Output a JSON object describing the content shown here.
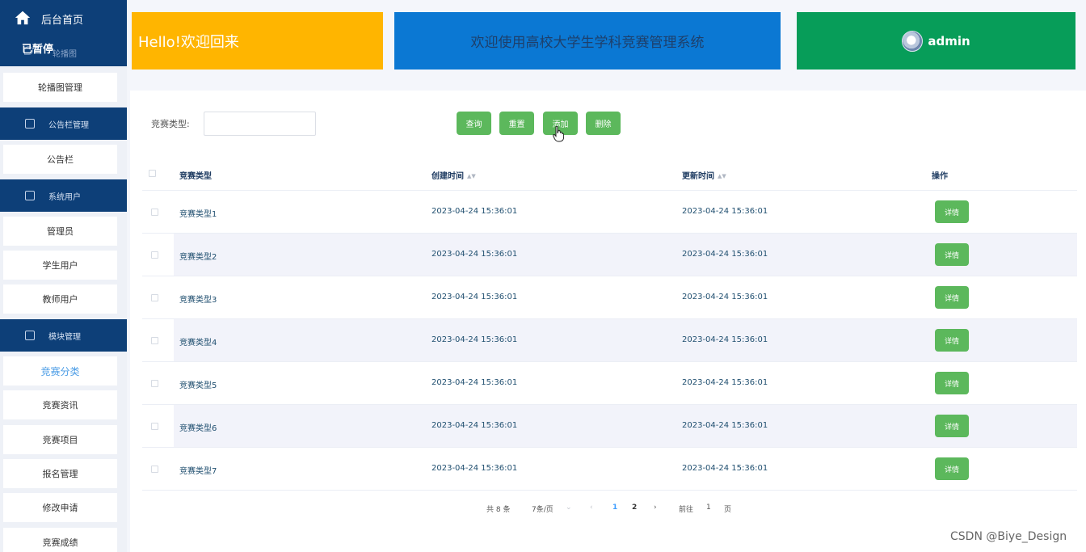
{
  "sidebar": {
    "home_label": "后台首页",
    "paused_overlay": "已暂停",
    "sub_label": "轮播图",
    "groups": [
      {
        "label": "公告栏管理",
        "icon": "edit-icon"
      },
      {
        "label": "系统用户",
        "icon": "user-card-icon"
      },
      {
        "label": "模块管理",
        "icon": "chart-icon"
      }
    ],
    "items": [
      "轮播图管理",
      "公告栏",
      "管理员",
      "学生用户",
      "教师用户",
      "竞赛分类",
      "竞赛资讯",
      "竞赛项目",
      "报名管理",
      "修改申请",
      "竞赛成绩"
    ]
  },
  "header": {
    "greeting": "Hello!欢迎回来",
    "system_title": "欢迎使用高校大学生学科竞赛管理系统",
    "user": "admin"
  },
  "filter": {
    "label": "竞赛类型:",
    "value": "",
    "buttons": [
      "查询",
      "重置",
      "添加",
      "删除"
    ]
  },
  "table": {
    "columns": [
      "竞赛类型",
      "创建时间",
      "更新时间",
      "操作"
    ],
    "rows": [
      {
        "type": "竞赛类型1",
        "created": "2023-04-24 15:36:01",
        "updated": "2023-04-24 15:36:01",
        "action": "详情"
      },
      {
        "type": "竞赛类型2",
        "created": "2023-04-24 15:36:01",
        "updated": "2023-04-24 15:36:01",
        "action": "详情"
      },
      {
        "type": "竞赛类型3",
        "created": "2023-04-24 15:36:01",
        "updated": "2023-04-24 15:36:01",
        "action": "详情"
      },
      {
        "type": "竞赛类型4",
        "created": "2023-04-24 15:36:01",
        "updated": "2023-04-24 15:36:01",
        "action": "详情"
      },
      {
        "type": "竞赛类型5",
        "created": "2023-04-24 15:36:01",
        "updated": "2023-04-24 15:36:01",
        "action": "详情"
      },
      {
        "type": "竞赛类型6",
        "created": "2023-04-24 15:36:01",
        "updated": "2023-04-24 15:36:01",
        "action": "详情"
      },
      {
        "type": "竞赛类型7",
        "created": "2023-04-24 15:36:01",
        "updated": "2023-04-24 15:36:01",
        "action": "详情"
      }
    ]
  },
  "pagination": {
    "total": "共 8 条",
    "page_size": "7条/页",
    "pages": [
      "1",
      "2"
    ],
    "current": "1",
    "goto_label": "前往",
    "goto_value": "1",
    "page_suffix": "页"
  },
  "watermark": "CSDN @Biye_Design",
  "colors": {
    "sidebar_dark": "#0d3f78",
    "banner_yellow": "#ffb500",
    "banner_blue": "#0b78d3",
    "banner_green": "#079d59",
    "button_green": "#5cb85c",
    "active_link": "#4c9de6"
  }
}
